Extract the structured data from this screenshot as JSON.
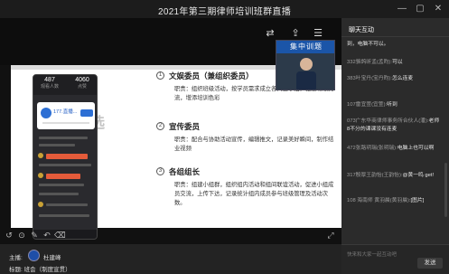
{
  "window": {
    "title": "2021年第三期律师培训班群直播"
  },
  "player": {
    "pip_banner": "集中训题",
    "ghost_text": "选",
    "phone": {
      "stat1_value": "487",
      "stat1_label": "观看人数",
      "stat2_value": "4060",
      "stat2_label": "点赞",
      "card_name": "177.直播..."
    },
    "slide": {
      "sections": [
        {
          "num": "1",
          "title": "文娱委员（兼组织委员）",
          "body": "职责：组织班级活动，按学员需求成立各兴趣小组，促进班级交流，增添培训色彩"
        },
        {
          "num": "2",
          "title": "宣传委员",
          "body": "职责：配合与协助活动宣传，编辑推文，记录美好瞬间，制作结业视频"
        },
        {
          "num": "3",
          "title": "各组组长",
          "body": "职责：组建小组群，组织组内活动和组间联谊活动，促进小组成员交流，上传下达，记录统计组内成员参与班级管理及活动次数。"
        }
      ]
    }
  },
  "footer": {
    "host_label": "主播:",
    "host_name": "杜建峰",
    "subject_label": "标题:",
    "subject": "班会（制度宣贯）"
  },
  "chat": {
    "header": "聊天互动",
    "messages": [
      {
        "user": "",
        "text": "到，电脑不可以。"
      },
      {
        "user": "332骆鸽昕孟(孟昀):",
        "text": "可以"
      },
      {
        "user": "383叶宝丹(宝丹昀):",
        "text": "怎么连麦"
      },
      {
        "user": "107雷宜萱(宜萱):",
        "text": "听到"
      },
      {
        "user": "073广东华商律师事务所合伙人(潘):",
        "text": "老师8不分的课课没有连麦"
      },
      {
        "user": "472张路玥瑞(张玥瑞):",
        "text": "电脑上也可以啊"
      },
      {
        "user": "317殷厚王韵怡(王韵怡):",
        "text": "@黄一鸣 get!"
      },
      {
        "user": "108 海南师 黄羽晨(黄羽晨):",
        "text": "[图片]"
      }
    ],
    "input_placeholder": "快来和大家一起互动吧",
    "send_label": "发送"
  }
}
